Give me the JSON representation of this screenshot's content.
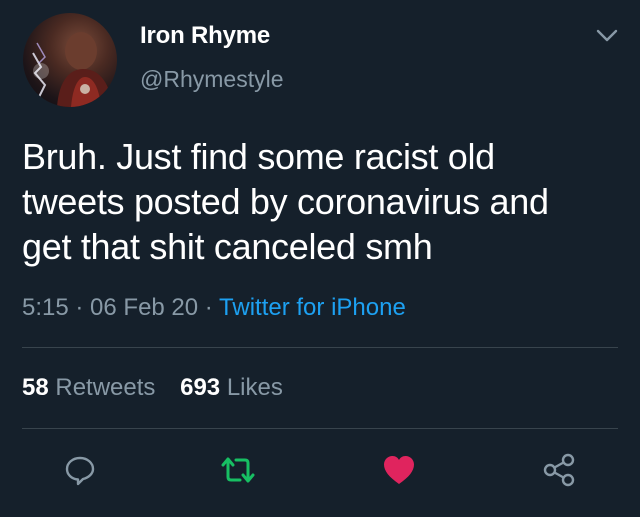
{
  "tweet": {
    "author_name": "Iron Rhyme",
    "author_handle": "@Rhymestyle",
    "text_lines": [
      "Bruh. Just find some racist old",
      "tweets posted by coronavirus and",
      "get that shit canceled smh"
    ],
    "time": "5:15",
    "separator": " · ",
    "date": "06 Feb 20",
    "source": "Twitter for iPhone",
    "retweets_count": "58",
    "retweets_label": "Retweets",
    "likes_count": "693",
    "likes_label": "Likes"
  },
  "icons": {
    "menu": "chevron-down-icon",
    "reply": "reply-icon",
    "retweet": "retweet-icon",
    "like": "heart-icon",
    "share": "share-icon"
  },
  "colors": {
    "background": "#15202b",
    "text": "#ffffff",
    "secondary": "#8899a6",
    "link": "#1da1f2",
    "retweet_active": "#17bf63",
    "like_active": "#e0245e",
    "divider": "#38444d"
  }
}
